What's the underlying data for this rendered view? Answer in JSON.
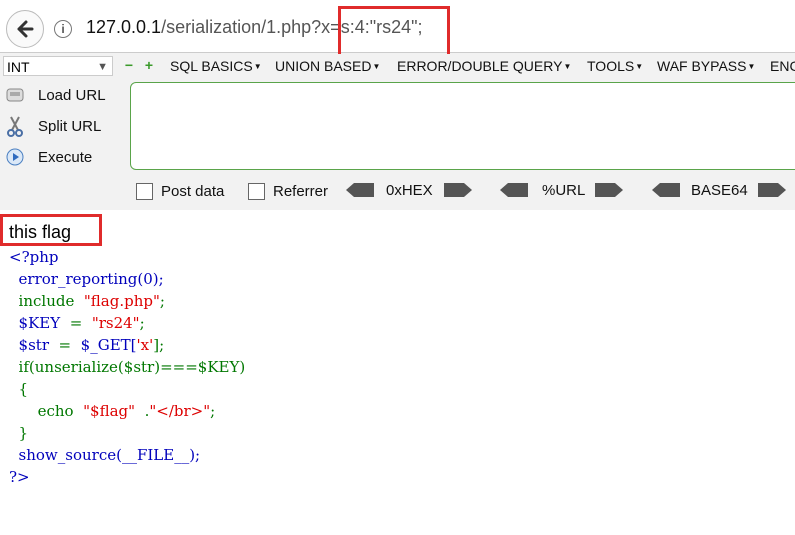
{
  "browser": {
    "url_host": "127.0.0.1",
    "url_path": "/serialization/1.php?x=s:4:\"rs24\";"
  },
  "hackbar": {
    "select_value": "INT",
    "menus": [
      "SQL BASICS",
      "UNION BASED",
      "ERROR/DOUBLE QUERY",
      "TOOLS",
      "WAF BYPASS",
      "ENC"
    ],
    "load_url": "Load URL",
    "split_url": "Split URL",
    "execute": "Execute",
    "post_data": "Post data",
    "referrer": "Referrer",
    "hex": "0xHEX",
    "url_enc": "%URL",
    "base64": "BASE64"
  },
  "page": {
    "flag_text": "this flag",
    "code": {
      "open": "<?php",
      "l1": "error_reporting(0);",
      "l2_kw": "include",
      "l2_str": "\"flag.php\"",
      "l3_var": "$KEY",
      "l3_eq": "=",
      "l3_str": "\"rs24\"",
      "l4_var": "$str",
      "l4_eq": "=",
      "l4_rest": "$_GET[",
      "l4_str": "'x'",
      "l4_end": "];",
      "l5": "if(unserialize($str)===$KEY)",
      "l6": "{",
      "l7_kw": "echo",
      "l7_str1": "\"$flag\"",
      "l7_dot": ".",
      "l7_str2": "\"</br>\"",
      "l7_end": ";",
      "l8": "}",
      "l9": "show_source(__FILE__);",
      "close": "?>"
    }
  },
  "colors": {
    "highlight": "#e02b2b",
    "php_default": "#0000bb",
    "php_keyword": "#007700",
    "php_string": "#dd0000"
  }
}
